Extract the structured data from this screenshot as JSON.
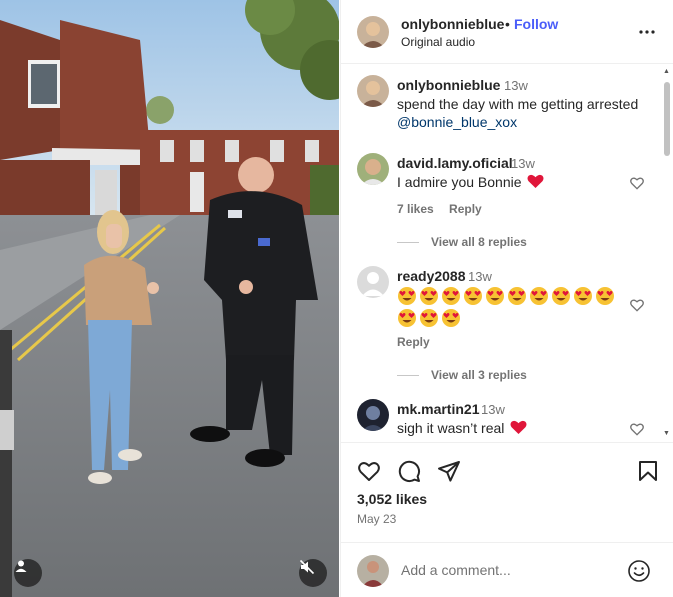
{
  "post": {
    "username": "onlybonnieblue",
    "separator": "•",
    "follow_label": "Follow",
    "audio": "Original audio",
    "likes": "3,052 likes",
    "date": "May 23"
  },
  "caption": {
    "username": "onlybonnieblue",
    "time": "13w",
    "text": "spend the day with me getting arrested",
    "mention": "@bonnie_blue_xox"
  },
  "comments": [
    {
      "username": "david.lamy.oficial",
      "time": "13w",
      "text": "I admire you Bonnie",
      "trailing_emoji": "red-heart",
      "likes": "7 likes",
      "reply_label": "Reply",
      "view_replies": "View all 8 replies"
    },
    {
      "username": "ready2088",
      "time": "13w",
      "emoji": "heart-eyes",
      "emoji_count": 13,
      "reply_label": "Reply",
      "view_replies": "View all 3 replies"
    },
    {
      "username": "mk.martin21",
      "time": "13w",
      "text": "sigh it wasn’t real",
      "trailing_emoji": "red-heart"
    }
  ],
  "add_comment": {
    "placeholder": "Add a comment..."
  },
  "icons": [
    "more-icon",
    "like-icon",
    "comment-icon",
    "share-icon",
    "save-icon",
    "emoji-icon",
    "user-tag-icon",
    "mute-icon"
  ],
  "colors": {
    "follow": "#4a5df9",
    "mention": "#00376b",
    "muted_text": "#737373",
    "heart": "#e0163a"
  }
}
